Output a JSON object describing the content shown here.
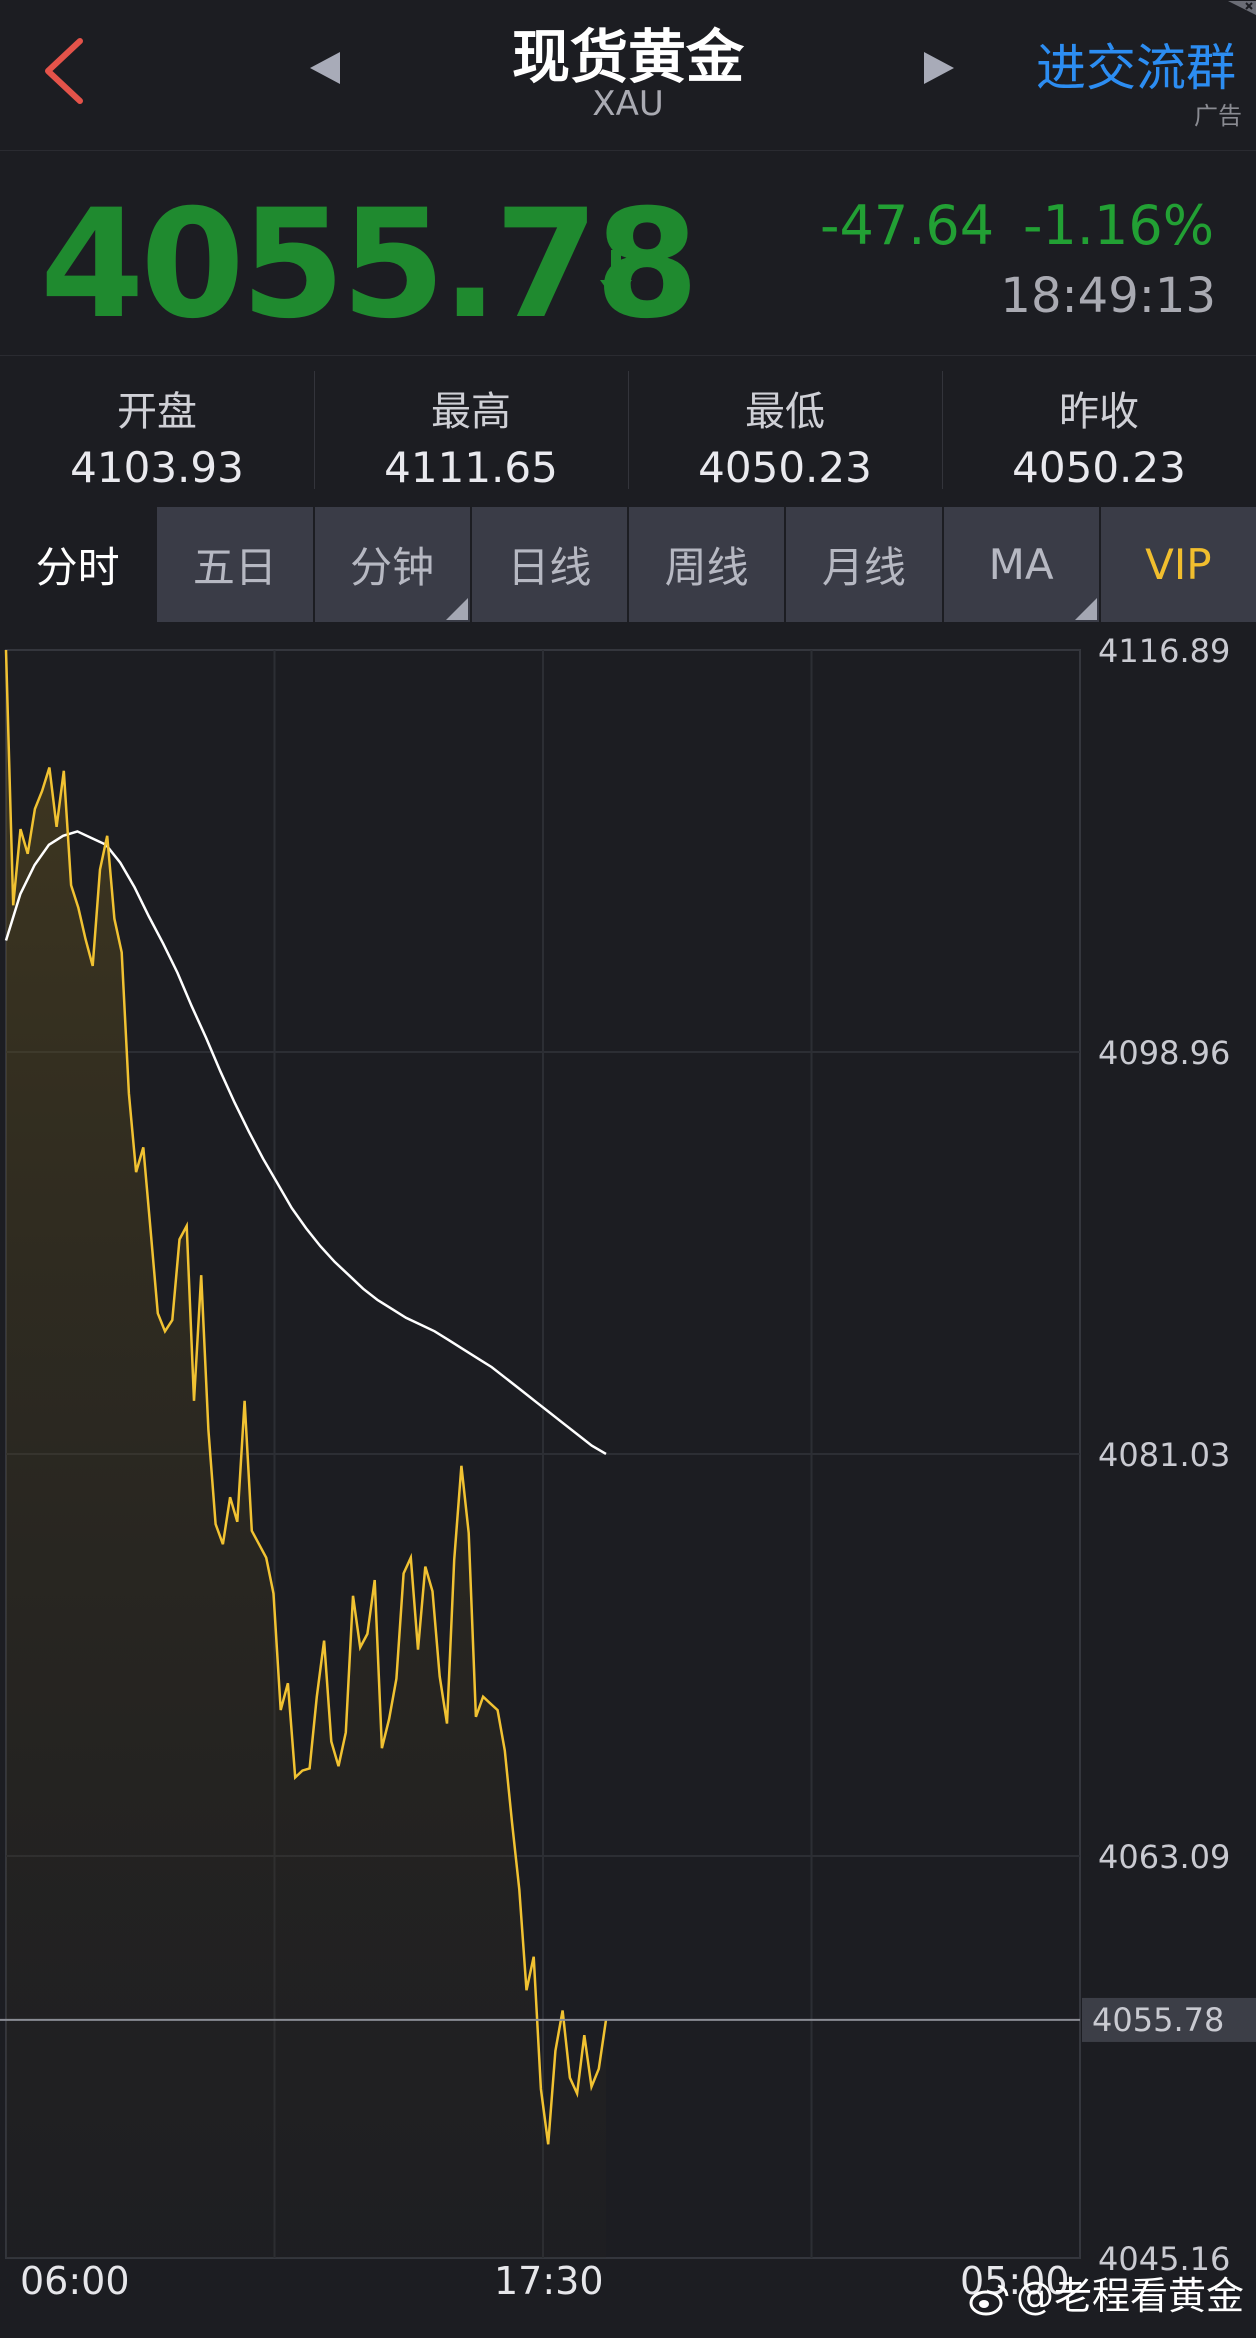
{
  "header": {
    "title": "现货黄金",
    "subtitle": "XAU",
    "ad_link": "进交流群",
    "ad_tag": "广告"
  },
  "quote": {
    "price": "4055.78",
    "change": "-47.64",
    "change_pct": "-1.16%",
    "time": "18:49:13"
  },
  "stats": [
    {
      "label": "开盘",
      "value": "4103.93"
    },
    {
      "label": "最高",
      "value": "4111.65"
    },
    {
      "label": "最低",
      "value": "4050.23"
    },
    {
      "label": "昨收",
      "value": "4050.23"
    }
  ],
  "tabs": [
    {
      "label": "分时"
    },
    {
      "label": "五日"
    },
    {
      "label": "分钟"
    },
    {
      "label": "日线"
    },
    {
      "label": "周线"
    },
    {
      "label": "月线"
    },
    {
      "label": "MA"
    },
    {
      "label": "VIP"
    }
  ],
  "colors": {
    "background": "#1c1d22",
    "price_down": "#1f8a2f",
    "ad_blue": "#2c8df2",
    "price_line": "#f1c232",
    "avg_line": "#ffffff",
    "vip": "#f1be2e",
    "back_arrow": "#e4534a"
  },
  "icons": {
    "back": "chevron-left-icon",
    "prev": "triangle-left-icon",
    "next": "triangle-right-icon",
    "trend": "arrow-down-icon"
  },
  "chart_data": {
    "type": "line",
    "x_ticks": [
      "06:00",
      "17:30",
      "05:00"
    ],
    "y_ticks": [
      4116.89,
      4098.96,
      4081.03,
      4063.09,
      4045.16
    ],
    "ylim": [
      4045.16,
      4116.89
    ],
    "last_price_label": "4055.78",
    "series": [
      {
        "values": [
          4116.89,
          4105.5,
          4108.9,
          4107.8,
          4109.8,
          4110.6,
          4111.65,
          4109.0,
          4111.5,
          4106.4,
          4105.4,
          4104.0,
          4102.8,
          4107.1,
          4108.6,
          4104.9,
          4103.4,
          4097.1,
          4093.6,
          4094.7,
          4091.0,
          4087.3,
          4086.5,
          4087.0,
          4090.6,
          4091.2,
          4083.4,
          4089.0,
          4082.1,
          4077.9,
          4077.0,
          4079.1,
          4078.0,
          4083.4,
          4077.6,
          4077.0,
          4076.4,
          4074.8,
          4069.6,
          4070.8,
          4066.6,
          4066.9,
          4067.0,
          4070.2,
          4072.7,
          4068.2,
          4067.1,
          4068.6,
          4074.7,
          4072.4,
          4073.0,
          4075.4,
          4067.9,
          4069.2,
          4071.0,
          4075.7,
          4076.4,
          4072.3,
          4076.0,
          4074.9,
          4071.1,
          4069.0,
          4076.3,
          4080.5,
          4077.5,
          4069.3,
          4070.2,
          4069.9,
          4069.6,
          4067.8,
          4064.6,
          4061.6,
          4057.1,
          4058.6,
          4052.7,
          4050.23,
          4054.4,
          4056.2,
          4053.2,
          4052.5,
          4055.1,
          4052.8,
          4053.6,
          4055.78
        ]
      },
      {
        "values": [
          4103.93,
          4106.0,
          4107.3,
          4108.2,
          4108.6,
          4108.8,
          4108.5,
          4108.2,
          4107.4,
          4106.3,
          4105.0,
          4103.8,
          4102.5,
          4101.0,
          4099.6,
          4098.1,
          4096.7,
          4095.4,
          4094.2,
          4093.1,
          4092.0,
          4091.1,
          4090.3,
          4089.6,
          4089.0,
          4088.4,
          4087.9,
          4087.5,
          4087.1,
          4086.8,
          4086.5,
          4086.1,
          4085.7,
          4085.3,
          4084.9,
          4084.4,
          4083.9,
          4083.4,
          4082.9,
          4082.4,
          4081.9,
          4081.4,
          4081.03
        ]
      }
    ]
  },
  "watermark": "@老程看黄金"
}
